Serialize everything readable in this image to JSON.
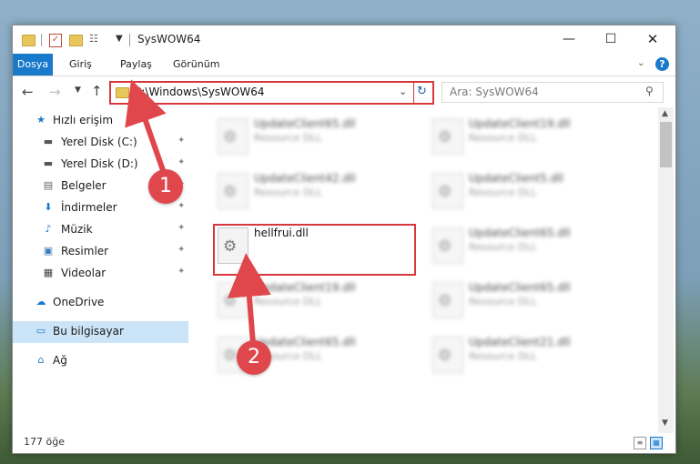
{
  "window": {
    "title": "SysWOW64",
    "minimize_label": "—",
    "maximize_label": "☐",
    "close_label": "✕"
  },
  "ribbon": {
    "tabs": [
      {
        "label": "Dosya"
      },
      {
        "label": "Giriş"
      },
      {
        "label": "Paylaş"
      },
      {
        "label": "Görünüm"
      }
    ],
    "help_label": "?"
  },
  "nav": {
    "address": "C:\\Windows\\SysWOW64",
    "search_placeholder": "Ara: SysWOW64"
  },
  "sidebar": {
    "items": [
      {
        "label": "Hızlı erişim",
        "icon": "star-icon"
      },
      {
        "label": "Yerel Disk (C:)",
        "icon": "drive-icon"
      },
      {
        "label": "Yerel Disk (D:)",
        "icon": "drive-icon"
      },
      {
        "label": "Belgeler",
        "icon": "documents-icon"
      },
      {
        "label": "İndirmeler",
        "icon": "download-icon"
      },
      {
        "label": "Müzik",
        "icon": "music-icon"
      },
      {
        "label": "Resimler",
        "icon": "pictures-icon"
      },
      {
        "label": "Videolar",
        "icon": "video-icon"
      },
      {
        "label": "OneDrive",
        "icon": "cloud-icon"
      },
      {
        "label": "Bu bilgisayar",
        "icon": "computer-icon"
      },
      {
        "label": "Ağ",
        "icon": "network-icon"
      }
    ]
  },
  "files": [
    {
      "name": "UpdateClient65.dll",
      "type": "Resource DLL"
    },
    {
      "name": "UpdateClient19.dll",
      "type": "Resource DLL"
    },
    {
      "name": "UpdateClient42.dll",
      "type": "Resource DLL"
    },
    {
      "name": "UpdateClient5.dll",
      "type": "Resource DLL"
    },
    {
      "name": "hellfrui.dll",
      "type": ""
    },
    {
      "name": "UpdateClient65.dll",
      "type": "Resource DLL"
    },
    {
      "name": "UpdateClient19.dll",
      "type": "Resource DLL"
    },
    {
      "name": "UpdateClient65.dll",
      "type": "Resource DLL"
    },
    {
      "name": "UpdateClient65.dll",
      "type": "Resource DLL"
    },
    {
      "name": "UpdateClient21.dll",
      "type": "Resource DLL"
    }
  ],
  "status": {
    "item_count": "177 öğe"
  },
  "annotations": [
    {
      "label": "1"
    },
    {
      "label": "2"
    }
  ],
  "colors": {
    "accent": "#1979ca",
    "highlight": "#d7383e",
    "annotation": "#e0474c"
  }
}
